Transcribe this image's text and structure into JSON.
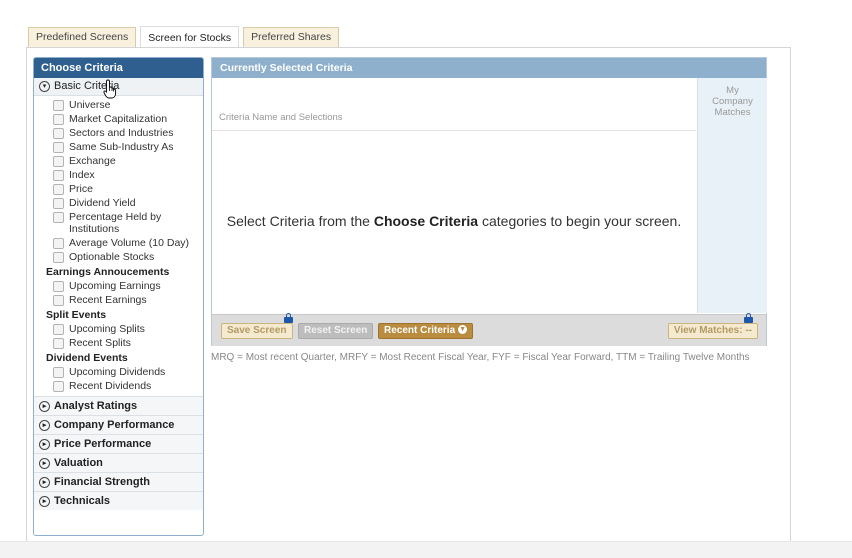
{
  "tabs": [
    {
      "label": "Predefined Screens"
    },
    {
      "label": "Screen for Stocks"
    },
    {
      "label": "Preferred Shares"
    }
  ],
  "choose_criteria": {
    "title": "Choose Criteria",
    "open_category": "Basic Criteria",
    "basic_items": [
      "Universe",
      "Market Capitalization",
      "Sectors and Industries",
      "Same Sub-Industry As",
      "Exchange",
      "Index",
      "Price",
      "Dividend Yield",
      "Percentage Held by Institutions",
      "Average Volume (10 Day)",
      "Optionable Stocks"
    ],
    "groups": [
      {
        "title": "Earnings Annoucements",
        "items": [
          "Upcoming Earnings",
          "Recent Earnings"
        ]
      },
      {
        "title": "Split Events",
        "items": [
          "Upcoming Splits",
          "Recent Splits"
        ]
      },
      {
        "title": "Dividend Events",
        "items": [
          "Upcoming Dividends",
          "Recent Dividends"
        ]
      }
    ],
    "categories": [
      "Analyst Ratings",
      "Company Performance",
      "Price Performance",
      "Valuation",
      "Financial Strength",
      "Technicals"
    ]
  },
  "selected": {
    "title": "Currently Selected Criteria",
    "column_label": "Criteria Name and Selections",
    "matches_label": [
      "My",
      "Company",
      "Matches"
    ],
    "empty_pre": "Select Criteria from the ",
    "empty_bold": "Choose Criteria",
    "empty_post": " categories to begin your screen.",
    "buttons": {
      "save": "Save Screen",
      "reset": "Reset Screen",
      "recent": "Recent Criteria",
      "view": "View Matches: --"
    }
  },
  "legend": "MRQ = Most recent Quarter, MRFY = Most Recent Fiscal Year, FYF = Fiscal Year Forward, TTM = Trailing Twelve Months",
  "colors": {
    "header_blue": "#2f5f8e",
    "panel_blue": "#8fb0cc",
    "recent_button": "#b98c3f",
    "lock_blue": "#1f57a8"
  }
}
